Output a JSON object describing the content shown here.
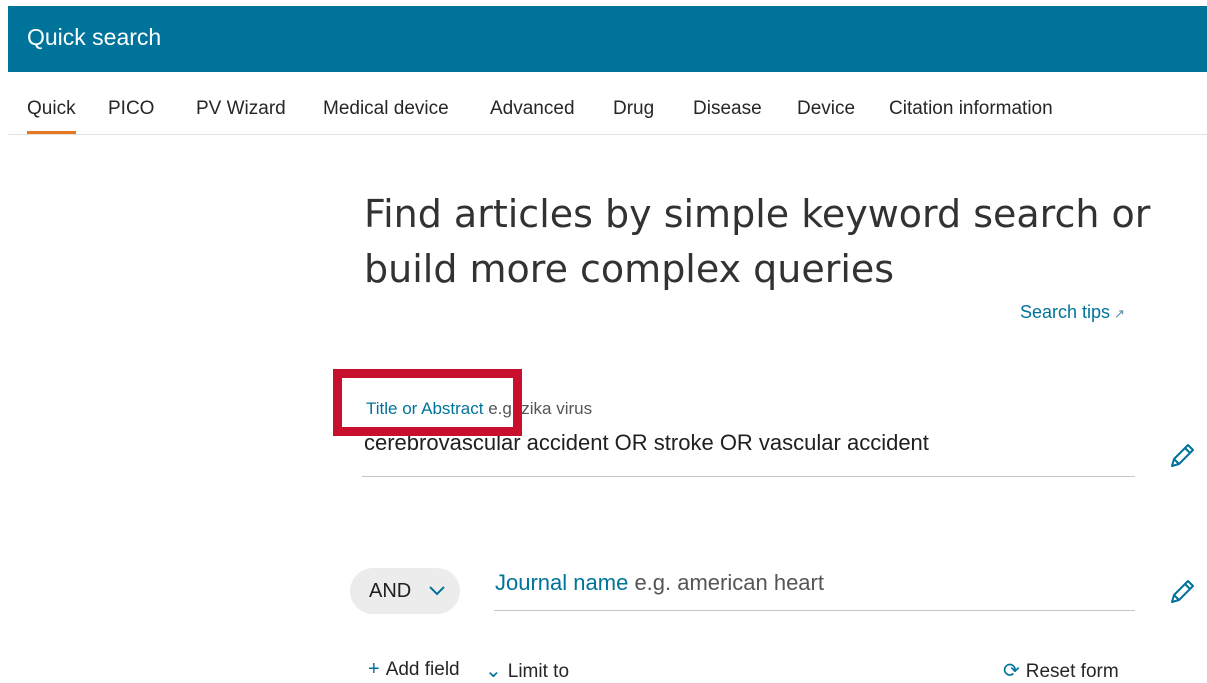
{
  "header": {
    "title": "Quick search"
  },
  "tabs": [
    {
      "label": "Quick",
      "active": true
    },
    {
      "label": "PICO"
    },
    {
      "label": "PV Wizard"
    },
    {
      "label": "Medical device"
    },
    {
      "label": "Advanced"
    },
    {
      "label": "Drug"
    },
    {
      "label": "Disease"
    },
    {
      "label": "Device"
    },
    {
      "label": "Citation information"
    }
  ],
  "main": {
    "headline_line1": "Find articles by simple keyword search or",
    "headline_line2": "build more complex queries",
    "search_tips": "Search tips",
    "field1": {
      "label": "Title or Abstract",
      "hint": "e.g. zika virus",
      "value": "cerebrovascular accident OR stroke OR vascular accident"
    },
    "operator": "AND",
    "field2": {
      "label": "Journal name",
      "placeholder": "e.g. american heart"
    },
    "add_field": "Add field",
    "limit_to": "Limit to",
    "reset_form": "Reset form"
  },
  "colors": {
    "brand": "#00739a",
    "active_tab_underline": "#e87722",
    "highlight_box": "#c8102e"
  },
  "icons": [
    "pencil-icon",
    "chevron-down-icon",
    "plus-icon",
    "reset-icon",
    "external-arrow-icon"
  ]
}
